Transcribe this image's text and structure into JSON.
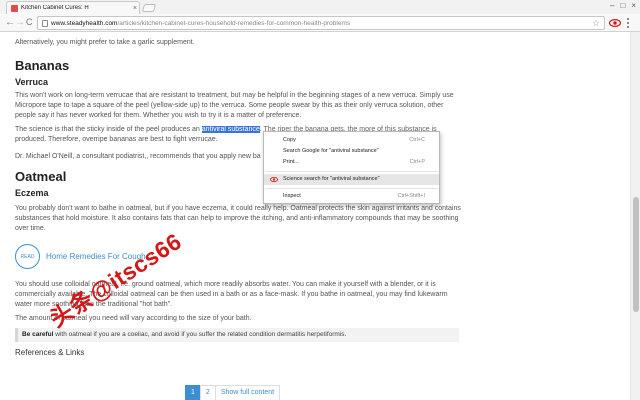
{
  "browser": {
    "tab_title": "Kitchen Cabinet Cures: H",
    "tab_close": "×",
    "url_domain": "www.steadyhealth.com",
    "url_path": "/articles/kitchen-cabinet-cures-household-remedies-for-common-health-problems",
    "back_glyph": "←",
    "forward_glyph": "→",
    "reload_glyph": "C",
    "star_glyph": "☆",
    "min_glyph": "–",
    "max_glyph": "□",
    "close_glyph": "×"
  },
  "article": {
    "intro": "Alternatively, you might prefer to take a garlic supplement.",
    "bananas_heading": "Bananas",
    "verruca_heading": "Verruca",
    "verruca_p1": "This won't work on long-term verrucae that are resistant to treatment, but may be helpful in the beginning stages of a new verruca. Simply use Micropore tape to tape a square of the peel (yellow-side up) to the verruca. Some people swear by this as their only verruca solution, other people say it has never worked for them. Whether you wish to try it is a matter of preference.",
    "verruca_p2_before": "The science is that the sticky inside of the peel produces an ",
    "verruca_p2_highlight": "antiviral substance",
    "verruca_p2_after": ". The riper the banana gets, the more of this substance is",
    "verruca_p2_line2": "produced. Therefore, overripe bananas are best to fight verrucae.",
    "verruca_p3": "Dr. Michael O'Neill, a consultant podiatrist,, recommends that you apply new ba",
    "oatmeal_heading": "Oatmeal",
    "eczema_heading": "Eczema",
    "eczema_p1": "You probably don't want to bathe in oatmeal, but if you have eczema, it could really help. Oatmeal protects the skin against irritants and contains substances that hold moisture. It also contains fats that can help to improve the itching, and anti-inflammatory compounds that may be soothing over time.",
    "read_badge": "READ",
    "related_link": "Home Remedies For Cough",
    "eczema_p2": "You should use colloidal oatmeal, i.e. ground oatmeal, which more readily absorbs water. You can make it yourself with a blender, or it is commercially available. The colloidal oatmeal can be then used in a bath or as a face-mask. If you bathe in oatmeal, you may find lukewarm water more soothing than the traditional \"hot bath\".",
    "eczema_p3": "The amount of oatmeal you need will vary according to the size of your bath.",
    "callout_bold": "Be careful",
    "callout_text": " with oatmeal if you are a coeliac, and avoid if you suffer the related condition dermatitis herpetiformis.",
    "references": "References & Links"
  },
  "pagination": {
    "pages": [
      "1",
      "2"
    ],
    "show_full": "Show full content"
  },
  "context_menu": {
    "copy": "Copy",
    "copy_shortcut": "Ctrl+C",
    "search_google": "Search Google for \"antiviral substance\"",
    "print": "Print...",
    "print_shortcut": "Ctrl+P",
    "science_search": "Science search for \"antiviral substance\"",
    "inspect": "Inspect",
    "inspect_shortcut": "Ctrl+Shift+I"
  },
  "watermark": {
    "text": "头条@itscs66"
  },
  "colors": {
    "link": "#3d8fcf",
    "selection": "#3875d7",
    "watermark": "#d51616"
  }
}
